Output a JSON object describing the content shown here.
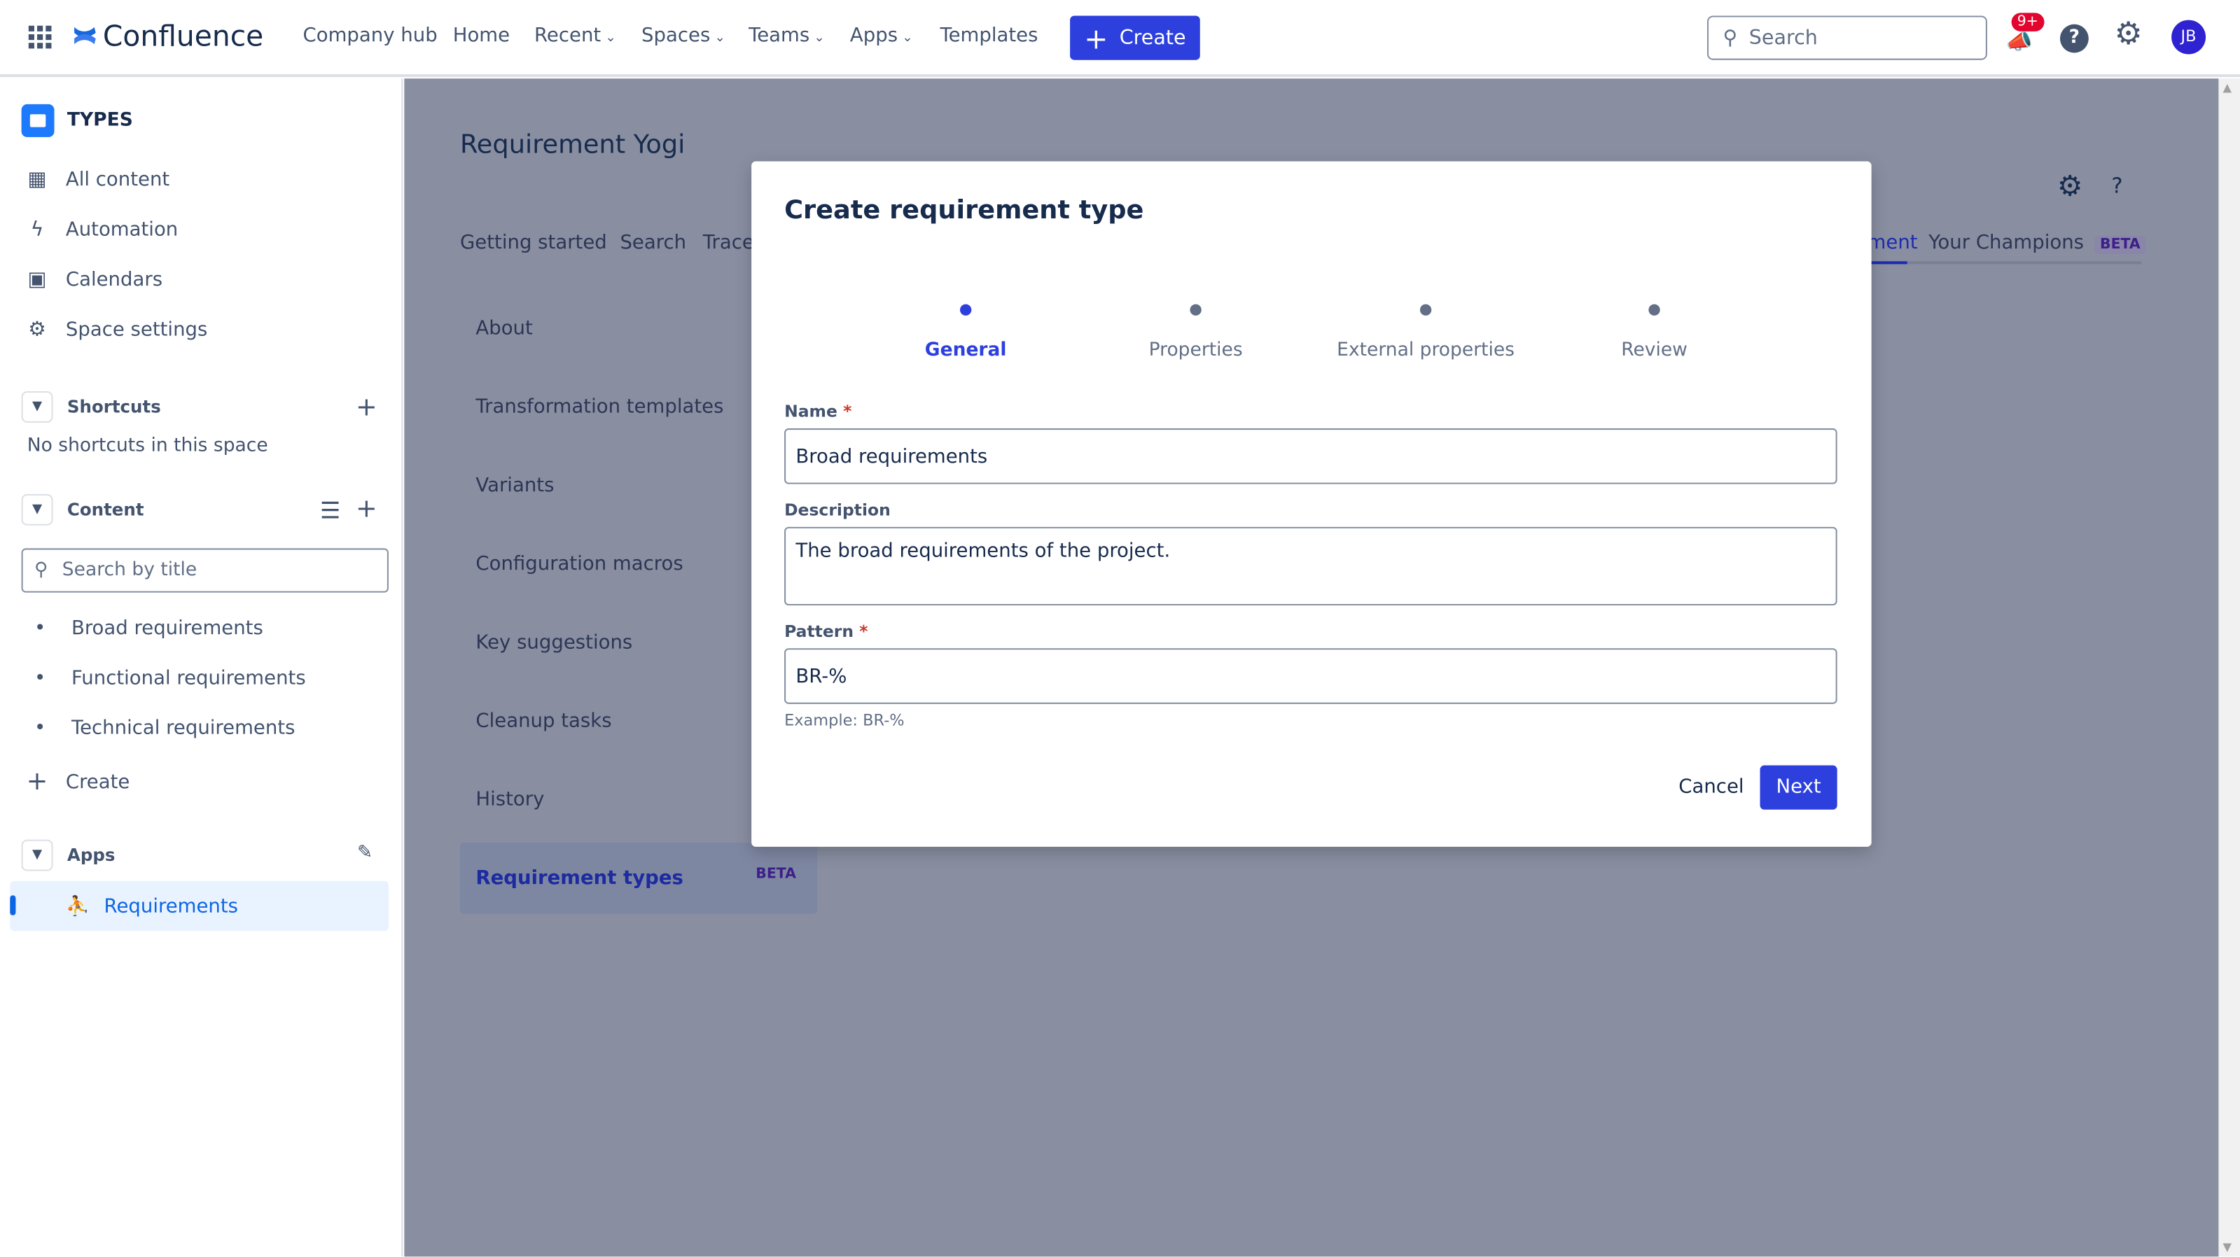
{
  "topnav": {
    "app_name": "Confluence",
    "items": [
      "Company hub",
      "Home",
      "Recent",
      "Spaces",
      "Teams",
      "Apps",
      "Templates"
    ],
    "create_label": "Create",
    "search_placeholder": "Search",
    "notification_badge": "9+",
    "avatar_initials": "JB"
  },
  "sidebar": {
    "space_title": "TYPES",
    "items": [
      {
        "label": "All content",
        "icon": "grid-icon"
      },
      {
        "label": "Automation",
        "icon": "lightning-icon"
      },
      {
        "label": "Calendars",
        "icon": "calendar-icon"
      },
      {
        "label": "Space settings",
        "icon": "gear-icon"
      }
    ],
    "shortcuts": {
      "label": "Shortcuts",
      "empty": "No shortcuts in this space"
    },
    "content": {
      "label": "Content",
      "search_placeholder": "Search by title",
      "pages": [
        "Broad requirements",
        "Functional requirements",
        "Technical requirements"
      ],
      "create_label": "Create"
    },
    "apps": {
      "label": "Apps",
      "items": [
        "Requirements"
      ]
    }
  },
  "main": {
    "title": "Requirement Yogi",
    "tabs": [
      "Getting started",
      "Search",
      "Trace",
      "ment",
      "Your Champions"
    ],
    "beta": "BETA",
    "left_nav": [
      "About",
      "Transformation templates",
      "Variants",
      "Configuration macros",
      "Key suggestions",
      "Cleanup tasks",
      "History",
      "Requirement types"
    ],
    "active_nav_badge": "BETA"
  },
  "modal": {
    "title": "Create requirement type",
    "steps": [
      "General",
      "Properties",
      "External properties",
      "Review"
    ],
    "active_step": 0,
    "name_label": "Name",
    "name_value": "Broad requirements",
    "description_label": "Description",
    "description_value": "The broad requirements of the project.",
    "pattern_label": "Pattern",
    "pattern_value": "BR-%",
    "pattern_hint": "Example: BR-%",
    "cancel_label": "Cancel",
    "next_label": "Next",
    "required_mark": "*"
  },
  "colors": {
    "accent": "#2d40de",
    "overlay": "#898ea1",
    "badge": "#e2062f",
    "avatar": "#2f22d0"
  }
}
